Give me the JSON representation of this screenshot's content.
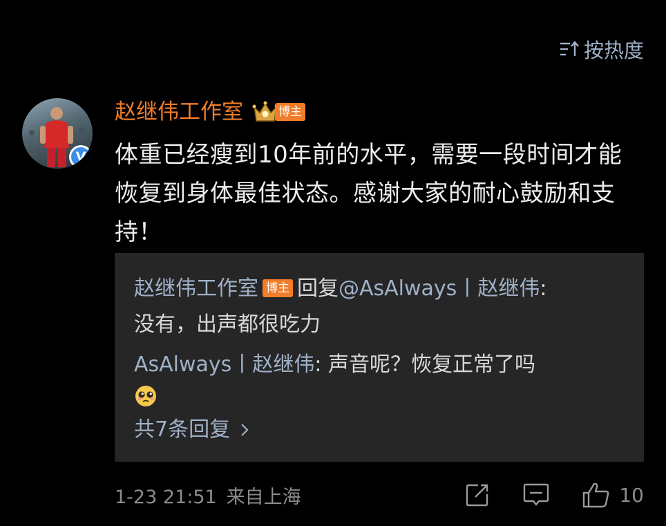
{
  "sort": {
    "label": "按热度",
    "icon": "sort-icon"
  },
  "comment": {
    "author": "赵继伟工作室",
    "author_badge": "博主",
    "crown_icon": "crown-icon",
    "verified_mark": "V",
    "text": "体重已经瘦到10年前的水平，需要一段时间才能恢复到身体最佳状态。感谢大家的耐心鼓励和支持！",
    "replies": [
      {
        "author": "赵继伟工作室",
        "badge": "博主",
        "reply_to_prefix": "回复",
        "reply_to": "@AsAlways丨赵继伟",
        "text": "没有，出声都很吃力"
      },
      {
        "author": "AsAlways丨赵继伟",
        "text": "声音呢？恢复正常了吗",
        "emoji": "pleading-face-emoji"
      }
    ],
    "more_replies": "共7条回复",
    "timestamp": "1-23 21:51",
    "location": "来自上海",
    "like_count": "10"
  },
  "colors": {
    "background": "#000000",
    "username": "#f07d2a",
    "link": "#9fb1c8",
    "reply_box": "#262626",
    "meta": "#8c8c8c",
    "verified": "#3d8eea"
  }
}
